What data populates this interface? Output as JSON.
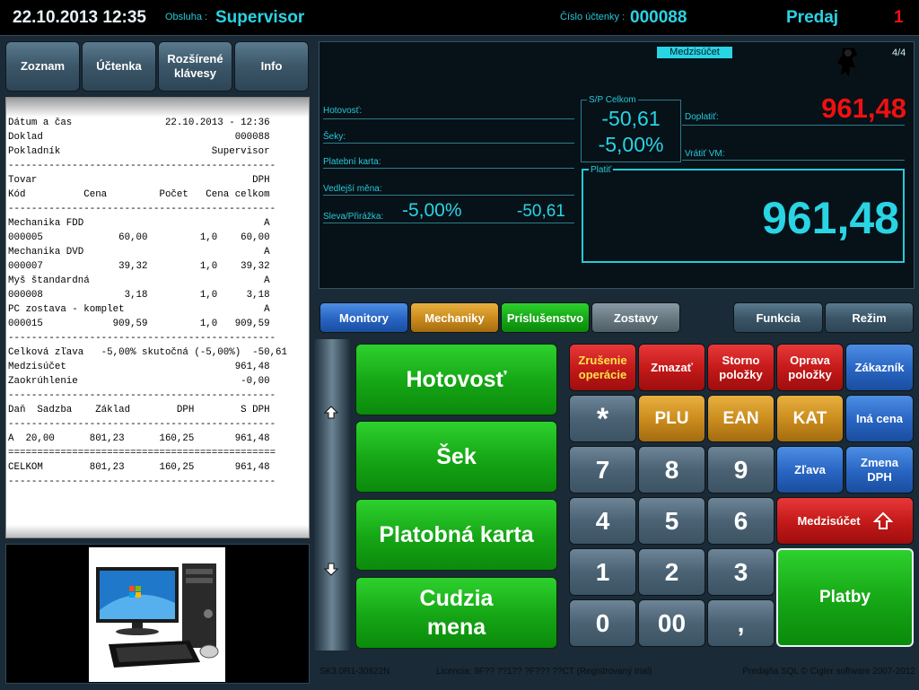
{
  "topbar": {
    "datetime": "22.10.2013 12:35",
    "operator_label": "Obsluha :",
    "operator": "Supervisor",
    "receipt_label": "Číslo účtenky :",
    "receipt_no": "000088",
    "mode": "Predaj",
    "count": "1"
  },
  "nav": {
    "list": "Zoznam",
    "receipt": "Účtenka",
    "ext_line1": "Rozšírené",
    "ext_line2": "klávesy",
    "info": "Info"
  },
  "receipt_lines": [
    "Dátum a čas                22.10.2013 - 12:36",
    "Doklad                                 000088",
    "Pokladník                          Supervisor",
    "----------------------------------------------",
    "Tovar                                     DPH",
    "Kód          Cena         Počet   Cena celkom",
    "----------------------------------------------",
    "Mechanika FDD                               A",
    "000005             60,00         1,0    60,00",
    "Mechanika DVD                               A",
    "000007             39,32         1,0    39,32",
    "Myš štandardná                              A",
    "000008              3,18         1,0     3,18",
    "PC zostava - komplet                        A",
    "000015            909,59         1,0   909,59",
    "----------------------------------------------",
    "Celková zľava   -5,00% skutočná (-5,00%)  -50,61",
    "Medzisúčet                             961,48",
    "Zaokrúhlenie                            -0,00",
    "----------------------------------------------",
    "Daň  Sadzba    Základ        DPH        S DPH",
    "----------------------------------------------",
    "A  20,00      801,23      160,25       961,48",
    "==============================================",
    "CELKOM        801,23      160,25       961,48",
    "----------------------------------------------"
  ],
  "display": {
    "subtotal_label": "Medzisúčet",
    "page": "4/4",
    "cash_label": "Hotovosť:",
    "checks_label": "Šeky:",
    "card_label": "Platební karta:",
    "foreign_label": "Vedlejší měna:",
    "discount_label": "Sleva/Přirážka:",
    "discount_pct": "-5,00%",
    "discount_amt": "-50,61",
    "sp_label": "S/P Celkom",
    "sp_amount": "-50,61",
    "sp_pct": "-5,00%",
    "due_label": "Doplatiť:",
    "due_amount": "961,48",
    "change_label": "Vrátiť VM:",
    "pay_label": "Platiť",
    "pay_amount": "961,48"
  },
  "categories": {
    "monitors": "Monitory",
    "drives": "Mechaniky",
    "accessories": "Príslušenstvo",
    "sets": "Zostavy",
    "function": "Funkcia",
    "mode": "Režim"
  },
  "payments": {
    "cash": "Hotovosť",
    "check": "Šek",
    "card": "Platobná karta",
    "foreign_line1": "Cudzia",
    "foreign_line2": "mena"
  },
  "keys": {
    "cancel_line1": "Zrušenie",
    "cancel_line2": "operácie",
    "delete": "Zmazať",
    "storno_line1": "Storno",
    "storno_line2": "položky",
    "correct_line1": "Oprava",
    "correct_line2": "položky",
    "customer": "Zákazník",
    "star": "*",
    "plu": "PLU",
    "ean": "EAN",
    "kat": "KAT",
    "other_price": "Iná cena",
    "discount": "Zľava",
    "vat_line1": "Zmena",
    "vat_line2": "DPH",
    "subtotal": "Medzisúčet",
    "payments": "Platby",
    "d7": "7",
    "d8": "8",
    "d9": "9",
    "d4": "4",
    "d5": "5",
    "d6": "6",
    "d1": "1",
    "d2": "2",
    "d3": "3",
    "d0": "0",
    "d00": "00",
    "comma": ","
  },
  "status": {
    "version": "SK3.0R1-30822N",
    "license": "Licencia: 9F?? ??1?? ?F??? ??CT (Registrovaný trial)",
    "copyright": "Predajňa SQL © Cigler software 2007-2012"
  },
  "colors": {
    "cyan": "#29d4e4",
    "red": "#f01010",
    "green": "#15a515",
    "blue": "#2864c2",
    "orange": "#c98a1c"
  }
}
